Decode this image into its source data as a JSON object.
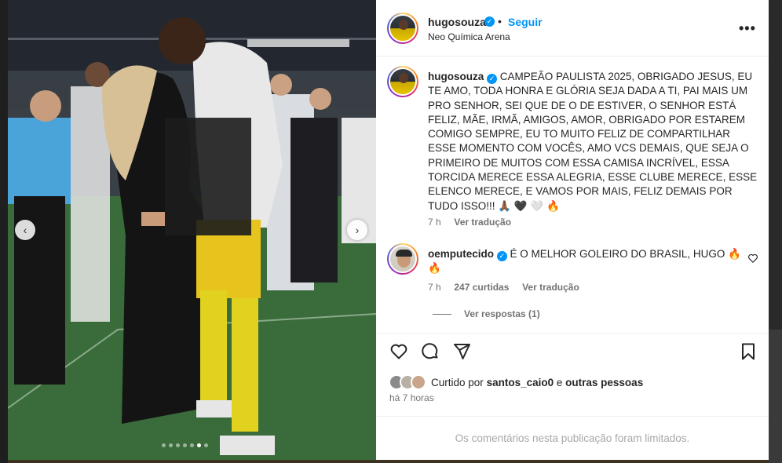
{
  "post": {
    "author": "hugosouza",
    "follow_label": "Seguir",
    "separator": "•",
    "location": "Neo Química Arena",
    "more_label": "•••",
    "caption": "CAMPEÃO PAULISTA 2025, OBRIGADO JESUS, EU TE AMO, TODA HONRA E GLÓRIA SEJA DADA A TI, PAI MAIS UM PRO SENHOR, SEI QUE DE O DE ESTIVER, O SENHOR ESTÁ FELIZ, MÃE, IRMÃ, AMIGOS, AMOR, OBRIGADO POR ESTAREM COMIGO SEMPRE, EU TO MUITO FELIZ DE COMPARTILHAR ESSE MOMENTO COM VOCÊS, AMO VCS DEMAIS, QUE SEJA O PRIMEIRO DE MUITOS COM ESSA CAMISA INCRÍVEL, ESSA TORCIDA MERECE ESSA ALEGRIA, ESSE CLUBE MERECE, ESSE ELENCO MERECE, E VAMOS POR MAIS, FELIZ DEMAIS POR TUDO ISSO!!! 🙏🏾 🖤 🤍 🔥",
    "caption_time": "7 h",
    "translate_label": "Ver tradução",
    "carousel": {
      "slide_count": 7,
      "active_index": 5
    }
  },
  "comment": {
    "author": "oemputecido",
    "text": "É O MELHOR GOLEIRO DO BRASIL, HUGO 🔥 🔥",
    "time": "7 h",
    "likes": "247 curtidas",
    "translate_label": "Ver tradução",
    "replies_label": "Ver respostas (1)"
  },
  "engagement": {
    "liked_by_prefix": "Curtido por",
    "liked_by_user": "santos_caio0",
    "liked_by_joiner": "e",
    "liked_by_others": "outras pessoas",
    "time_ago": "há 7 horas",
    "comments_limited": "Os comentários nesta publicação foram limitados."
  },
  "icons": {
    "verified": "verified-badge-icon",
    "like": "heart-icon",
    "comment": "comment-icon",
    "share": "share-icon",
    "save": "bookmark-icon",
    "prev": "chevron-left-icon",
    "next": "chevron-right-icon"
  },
  "colors": {
    "accent": "#0095f6",
    "text": "#262626",
    "muted": "#737373"
  }
}
